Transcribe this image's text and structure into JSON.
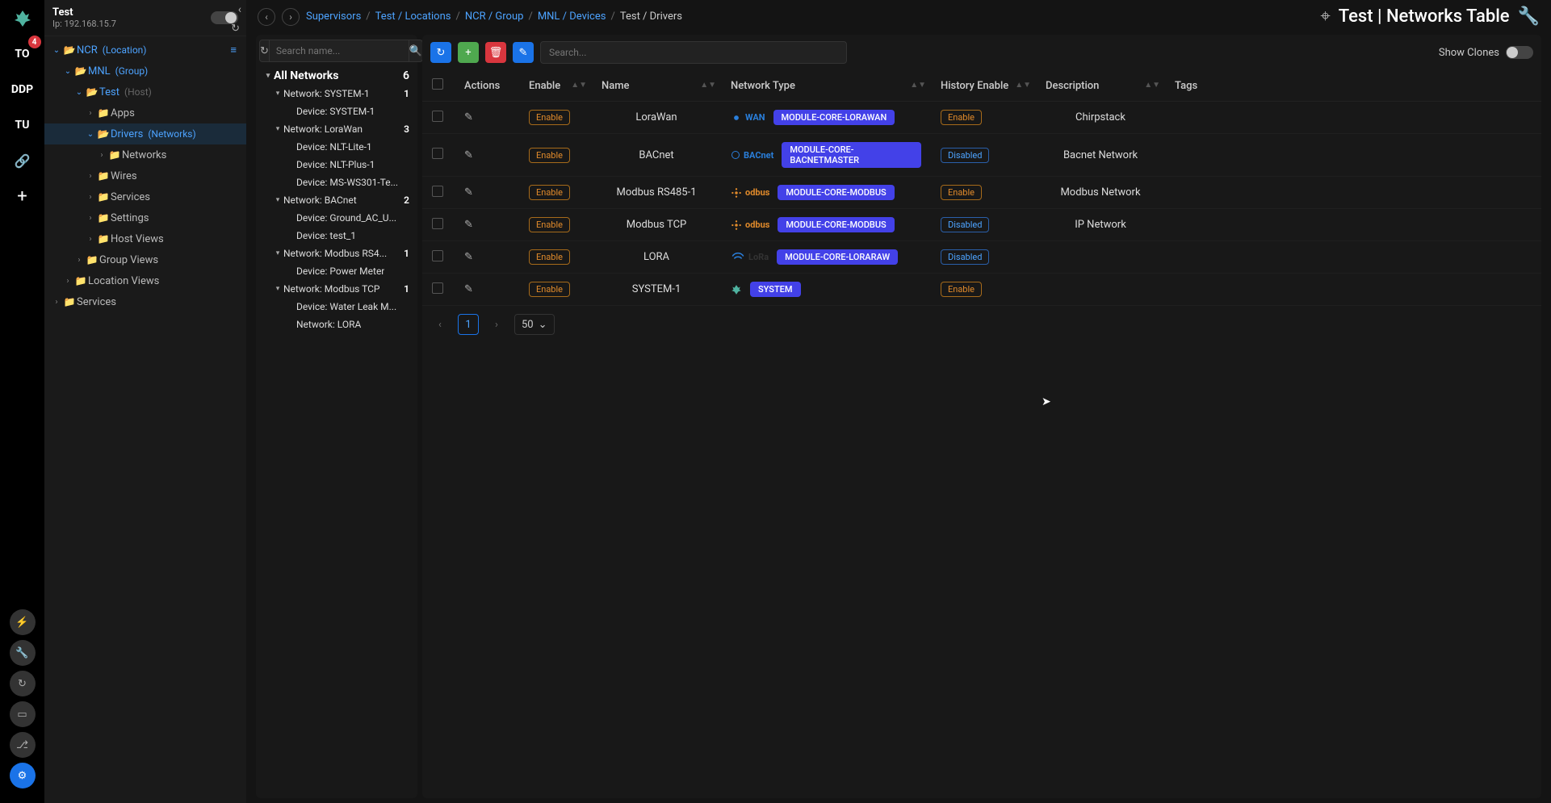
{
  "sidebar": {
    "title": "Test",
    "ip_label": "Ip: 192.168.15.7",
    "rail": {
      "badge": "4",
      "items": [
        "TO",
        "DDP",
        "TU"
      ],
      "link_glyph": "🔗",
      "plus_glyph": "+"
    }
  },
  "tree": {
    "ncr": {
      "label": "NCR",
      "suffix": "(Location)"
    },
    "mnl": {
      "label": "MNL",
      "suffix": "(Group)"
    },
    "test": {
      "label": "Test",
      "suffix": "(Host)"
    },
    "apps": "Apps",
    "drivers": {
      "label": "Drivers",
      "suffix": "(Networks)"
    },
    "networks": "Networks",
    "wires": "Wires",
    "services": "Services",
    "settings": "Settings",
    "host_views": "Host Views",
    "group_views": "Group Views",
    "location_views": "Location Views",
    "root_services": "Services"
  },
  "breadcrumb": {
    "items": [
      "Supervisors",
      "Test / Locations",
      "NCR / Group",
      "MNL / Devices",
      "Test / Drivers"
    ]
  },
  "page_title": {
    "left": "Test",
    "right": "Networks Table"
  },
  "mid": {
    "search_placeholder": "Search name...",
    "head": {
      "label": "All Networks",
      "count": "6"
    },
    "rows": [
      {
        "label": "Network: SYSTEM-1",
        "count": "1",
        "lvl": 1,
        "exp": true
      },
      {
        "label": "Device: SYSTEM-1",
        "lvl": 2
      },
      {
        "label": "Network: LoraWan",
        "count": "3",
        "lvl": 1,
        "exp": true
      },
      {
        "label": "Device: NLT-Lite-1",
        "lvl": 2
      },
      {
        "label": "Device: NLT-Plus-1",
        "lvl": 2
      },
      {
        "label": "Device: MS-WS301-Te...",
        "lvl": 2
      },
      {
        "label": "Network: BACnet",
        "count": "2",
        "lvl": 1,
        "exp": true
      },
      {
        "label": "Device: Ground_AC_U...",
        "lvl": 2
      },
      {
        "label": "Device: test_1",
        "lvl": 2
      },
      {
        "label": "Network: Modbus RS4...",
        "count": "1",
        "lvl": 1,
        "exp": true
      },
      {
        "label": "Device: Power Meter",
        "lvl": 2
      },
      {
        "label": "Network: Modbus TCP",
        "count": "1",
        "lvl": 1,
        "exp": true
      },
      {
        "label": "Device: Water Leak M...",
        "lvl": 2
      },
      {
        "label": "Network: LORA",
        "lvl": 2
      }
    ]
  },
  "table": {
    "search_placeholder": "Search...",
    "show_clones": "Show Clones",
    "columns": [
      "Actions",
      "Enable",
      "Name",
      "Network Type",
      "History Enable",
      "Description",
      "Tags"
    ],
    "rows": [
      {
        "enable": "Enable",
        "name": "LoraWan",
        "logo": "lorawan",
        "logo_text": "WAN",
        "module": "MODULE-CORE-LORAWAN",
        "history": "Enable",
        "desc": "Chirpstack"
      },
      {
        "enable": "Enable",
        "name": "BACnet",
        "logo": "bacnet",
        "logo_text": "BACnet",
        "module": "MODULE-CORE-BACNETMASTER",
        "history": "Disabled",
        "desc": "Bacnet Network"
      },
      {
        "enable": "Enable",
        "name": "Modbus RS485-1",
        "logo": "modbus",
        "logo_text": "odbus",
        "module": "MODULE-CORE-MODBUS",
        "history": "Enable",
        "desc": "Modbus Network"
      },
      {
        "enable": "Enable",
        "name": "Modbus TCP",
        "logo": "modbus",
        "logo_text": "odbus",
        "module": "MODULE-CORE-MODBUS",
        "history": "Disabled",
        "desc": "IP Network"
      },
      {
        "enable": "Enable",
        "name": "LORA",
        "logo": "lora",
        "logo_text": "LoRa",
        "module": "MODULE-CORE-LORARAW",
        "history": "Disabled",
        "desc": ""
      },
      {
        "enable": "Enable",
        "name": "SYSTEM-1",
        "logo": "rubix",
        "logo_text": "",
        "module": "SYSTEM",
        "history": "Enable",
        "desc": ""
      }
    ],
    "page": "1",
    "page_size": "50"
  },
  "chart_data": null
}
